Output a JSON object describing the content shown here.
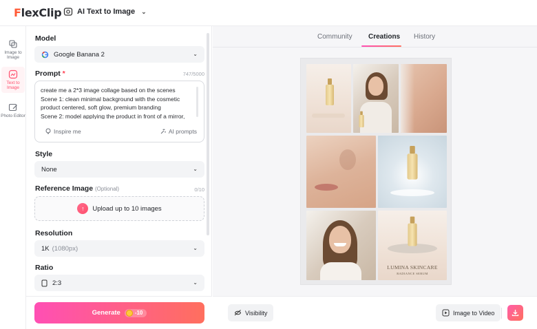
{
  "app": {
    "logo": "FlexClip",
    "tool_name": "AI Text to Image"
  },
  "rail": [
    {
      "label": "Image to Image",
      "icon": "image-swap-icon"
    },
    {
      "label": "Text to Image",
      "icon": "text-image-icon",
      "active": true
    },
    {
      "label": "Photo Editor",
      "icon": "photo-edit-icon"
    }
  ],
  "form": {
    "model": {
      "label": "Model",
      "value": "Google Banana 2"
    },
    "prompt": {
      "label": "Prompt",
      "required_mark": "*",
      "counter": "747/5000",
      "text": "create me a 2*3 image collage based on the scenes\nScene 1: clean minimal background with the cosmetic product centered, soft glow, premium branding\nScene 2: model applying the product in front of a mirror,",
      "inspire_label": "Inspire me",
      "ai_prompts_label": "AI prompts"
    },
    "style": {
      "label": "Style",
      "value": "None"
    },
    "reference": {
      "label": "Reference Image",
      "optional": "(Optional)",
      "counter": "0/10",
      "upload_label": "Upload up to 10 images"
    },
    "resolution": {
      "label": "Resolution",
      "value": "1K",
      "sub": "(1080px)"
    },
    "ratio": {
      "label": "Ratio",
      "value": "2:3"
    },
    "generate": {
      "label": "Generate",
      "credits": "-10"
    }
  },
  "tabs": [
    "Community",
    "Creations",
    "History"
  ],
  "active_tab": "Creations",
  "collage": {
    "brand_line1": "LUMINA SKINCARE",
    "brand_line2": "RADIANCE SERUM",
    "bottle_label": "LUMINA",
    "bottle_sub": "SERUM"
  },
  "actions": {
    "visibility": "Visibility",
    "image_to_video": "Image to Video"
  },
  "colors": {
    "accent": "#ff4f6d",
    "gradient_start": "#ff4fb4",
    "gradient_end": "#ff6f5e"
  }
}
